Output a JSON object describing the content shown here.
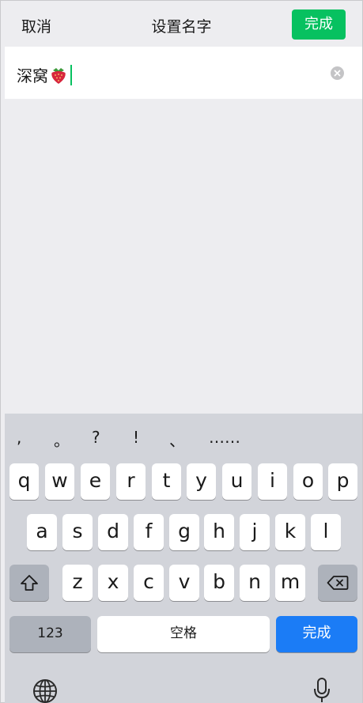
{
  "navbar": {
    "cancel_label": "取消",
    "title": "设置名字",
    "done_label": "完成"
  },
  "input": {
    "value_text": "深窝",
    "emoji": "strawberry-emoji"
  },
  "keyboard": {
    "punctuation": [
      ",",
      "。",
      "?",
      "!",
      "、",
      "……"
    ],
    "row1": [
      "q",
      "w",
      "e",
      "r",
      "t",
      "y",
      "u",
      "i",
      "o",
      "p"
    ],
    "row2": [
      "a",
      "s",
      "d",
      "f",
      "g",
      "h",
      "j",
      "k",
      "l"
    ],
    "row3": [
      "z",
      "x",
      "c",
      "v",
      "b",
      "n",
      "m"
    ],
    "numbers_label": "123",
    "space_label": "空格",
    "return_label": "完成",
    "icons": {
      "shift": "shift-icon",
      "delete": "backspace-icon",
      "globe": "globe-icon",
      "mic": "microphone-icon"
    }
  },
  "colors": {
    "accent_green": "#07c160",
    "return_blue": "#1b7cf6",
    "keyboard_bg": "#d2d4da"
  }
}
